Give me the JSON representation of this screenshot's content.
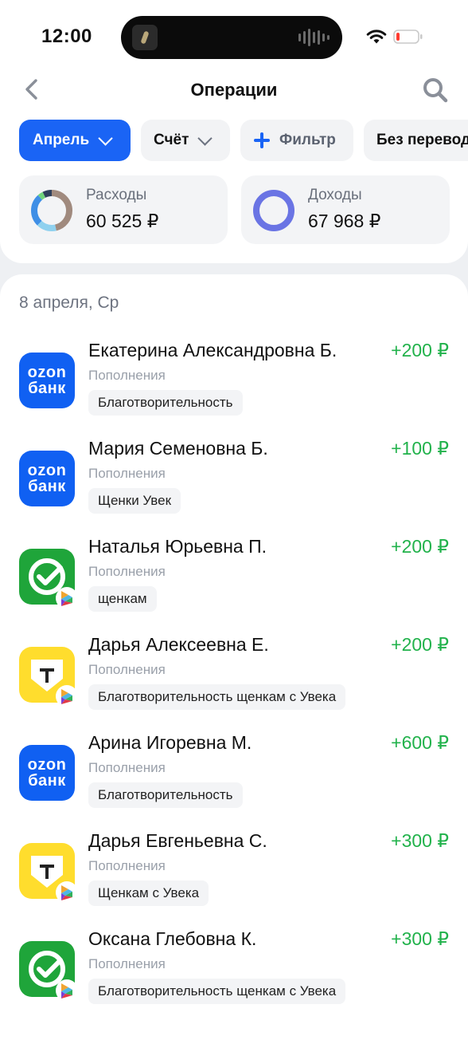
{
  "status_bar": {
    "time": "12:00"
  },
  "header": {
    "title": "Операции"
  },
  "filters": {
    "month_label": "Апрель",
    "account_label": "Счёт",
    "filter_label": "Фильтр",
    "no_transfers_label": "Без переводов"
  },
  "summary": {
    "expenses": {
      "label": "Расходы",
      "amount": "60 525 ₽"
    },
    "income": {
      "label": "Доходы",
      "amount": "67 968 ₽"
    }
  },
  "date_group": "8 апреля, Ср",
  "logos": {
    "ozon_line1": "ozon",
    "ozon_line2": "банк"
  },
  "operations": [
    {
      "name": "Екатерина Александровна Б.",
      "amount": "+200 ₽",
      "category": "Пополнения",
      "tag": "Благотворительность",
      "bank": "ozon"
    },
    {
      "name": "Мария Семеновна Б.",
      "amount": "+100 ₽",
      "category": "Пополнения",
      "tag": "Щенки Увек",
      "bank": "ozon"
    },
    {
      "name": "Наталья Юрьевна П.",
      "amount": "+200 ₽",
      "category": "Пополнения",
      "tag": "щенкам",
      "bank": "sber"
    },
    {
      "name": "Дарья Алексеевна Е.",
      "amount": "+200 ₽",
      "category": "Пополнения",
      "tag": "Благотворительность щенкам с Увека",
      "bank": "tbank"
    },
    {
      "name": "Арина Игоревна М.",
      "amount": "+600 ₽",
      "category": "Пополнения",
      "tag": "Благотворительность",
      "bank": "ozon"
    },
    {
      "name": "Дарья Евгеньевна С.",
      "amount": "+300 ₽",
      "category": "Пополнения",
      "tag": "Щенкам с Увека",
      "bank": "tbank"
    },
    {
      "name": "Оксана Глебовна К.",
      "amount": "+300 ₽",
      "category": "Пополнения",
      "tag": "Благотворительность щенкам с Увека",
      "bank": "sber"
    }
  ],
  "colors": {
    "accent": "#1a64f5",
    "income": "#21b24b",
    "ozon": "#1060f2",
    "sber": "#1fa53a",
    "tbank": "#ffdd2d"
  },
  "icons": {
    "back": "chevron-left-icon",
    "search": "search-icon",
    "dropdown": "chevron-down-icon",
    "add": "plus-icon",
    "sbp": "sbp-icon"
  }
}
